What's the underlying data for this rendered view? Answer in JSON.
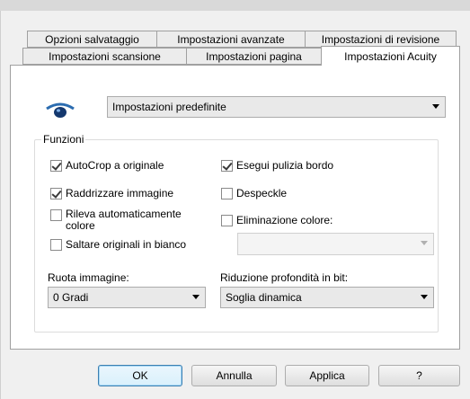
{
  "tabs_row1": [
    {
      "label": "Opzioni salvataggio"
    },
    {
      "label": "Impostazioni avanzate"
    },
    {
      "label": "Impostazioni di revisione"
    }
  ],
  "tabs_row2": [
    {
      "label": "Impostazioni scansione"
    },
    {
      "label": "Impostazioni pagina"
    },
    {
      "label": "Impostazioni Acuity"
    }
  ],
  "active_tab": "Impostazioni Acuity",
  "preset": {
    "value": "Impostazioni predefinite"
  },
  "functions": {
    "title": "Funzioni",
    "options": [
      {
        "label": "AutoCrop a originale",
        "checked": true
      },
      {
        "label": "Raddrizzare immagine",
        "checked": true
      },
      {
        "label": "Rileva automaticamente colore",
        "label_line1": "Rileva automaticamente",
        "label_line2": "colore",
        "checked": false
      },
      {
        "label": "Saltare originali in bianco",
        "checked": false
      },
      {
        "label": "Esegui pulizia bordo",
        "checked": true
      },
      {
        "label": "Despeckle",
        "checked": false
      },
      {
        "label": "Eliminazione colore:",
        "checked": false
      }
    ],
    "color_drop_value": ""
  },
  "rotate": {
    "label": "Ruota immagine:",
    "value": "0 Gradi"
  },
  "bitdepth": {
    "label": "Riduzione profondità in bit:",
    "value": "Soglia dinamica"
  },
  "buttons": {
    "ok": "OK",
    "cancel": "Annulla",
    "apply": "Applica",
    "help": "?"
  }
}
